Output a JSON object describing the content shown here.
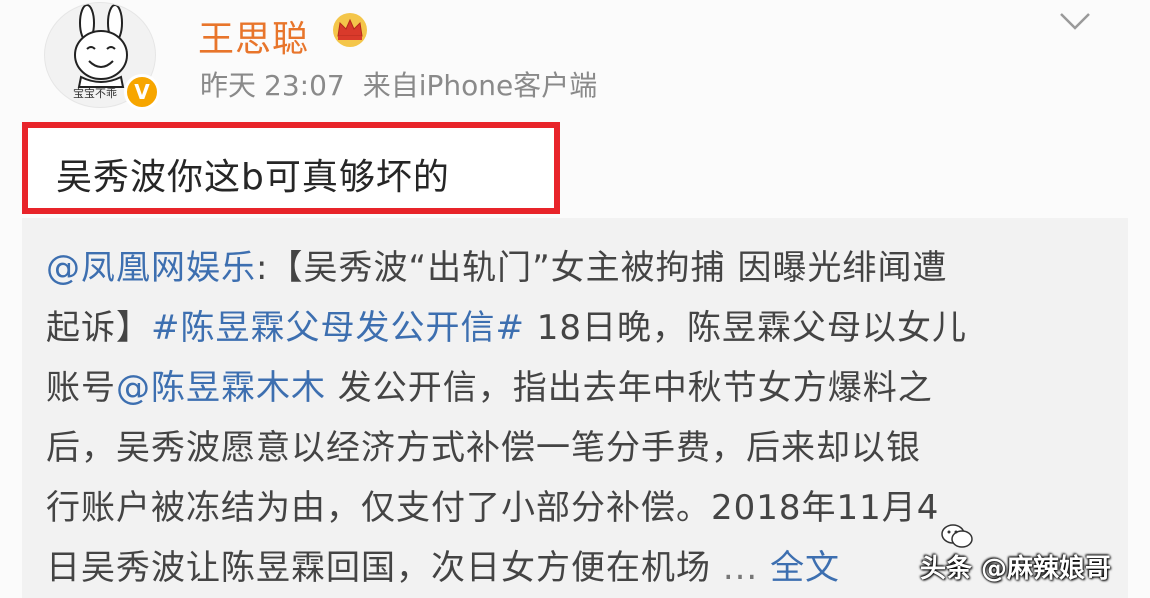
{
  "header": {
    "username": "王思聪",
    "avatar_caption": "宝宝不乖",
    "verified_mark": "V",
    "timestamp_day": "昨天",
    "timestamp_time": "23:07",
    "source": "来自iPhone客户端"
  },
  "post": {
    "text": "吴秀波你这b可真够坏的"
  },
  "repost": {
    "line1": {
      "mention": "@凤凰网娱乐",
      "text": ":【吴秀波“出轨门”女主被拘捕 因曝光绯闻遭"
    },
    "line2": {
      "prefix": "起诉】",
      "hashtag": "#陈昱霖父母发公开信#",
      "text": " 18日晚，陈昱霖父母以女儿"
    },
    "line3": {
      "prefix": "账号",
      "mention": "@陈昱霖木木",
      "text": " 发公开信，指出去年中秋节女方爆料之"
    },
    "line4": "后，吴秀波愿意以经济方式补偿一笔分手费，后来却以银",
    "line5": "行账户被冻结为由，仅支付了小部分补偿。2018年11月4",
    "line6": {
      "text": "日吴秀波让陈昱霖回国，次日女方便在机场 ",
      "ellipsis": "...",
      "expand": "全文"
    }
  },
  "watermark": {
    "text": "头条 @麻辣娘哥"
  },
  "colors": {
    "username": "#e8752b",
    "link": "#3d6fb0",
    "highlight_border": "#e8242a",
    "verified": "#f7a600",
    "meta": "#8a8a8a"
  },
  "icons": {
    "crown": "crown-icon",
    "chevron": "chevron-down-icon",
    "verified": "verified-badge",
    "wechat": "wechat-icon"
  }
}
